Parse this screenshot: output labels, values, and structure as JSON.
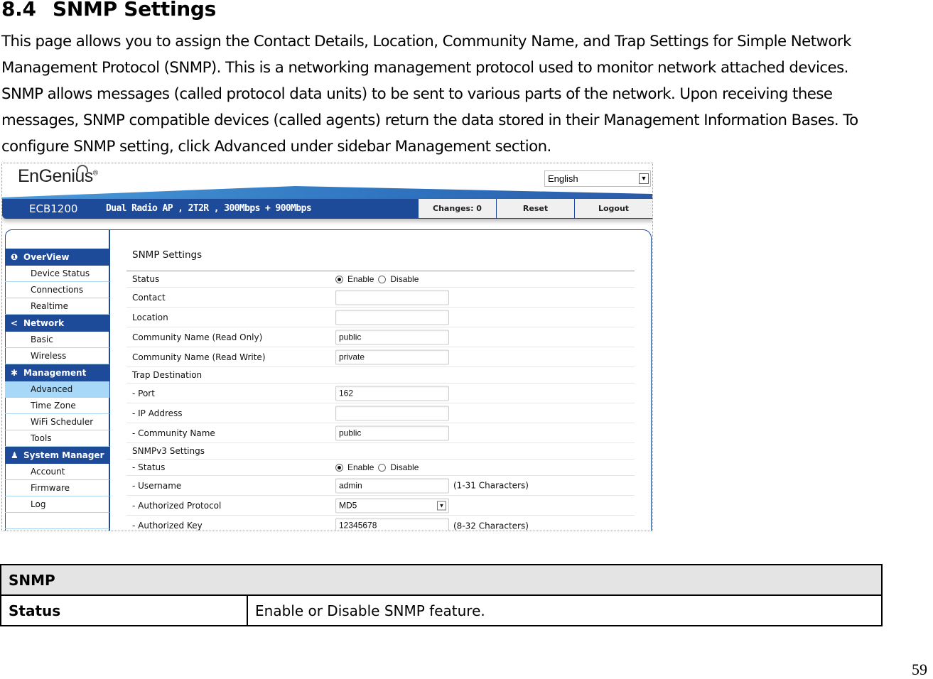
{
  "document": {
    "section_number": "8.4",
    "section_title": "SNMP Settings",
    "paragraph_lines": [
      "This page allows you to assign the Contact Details, Location, Community Name, and Trap Settings for Simple Network",
      "Management Protocol (SNMP). This is a networking management protocol used to monitor network attached devices.",
      "SNMP allows messages (called protocol data units) to be sent to various parts of the network. Upon receiving these",
      "messages, SNMP compatible devices (called agents) return the data stored in their Management Information Bases. To",
      "configure SNMP setting, click Advanced under sidebar Management section."
    ],
    "page_number": "59"
  },
  "ui": {
    "brand": "EnGenius",
    "brand_mark": "®",
    "language_select": "English",
    "model": "ECB1200",
    "model_description": "Dual Radio AP , 2T2R , 300Mbps + 900Mbps",
    "top_buttons": {
      "changes": "Changes: 0",
      "reset": "Reset",
      "logout": "Logout"
    },
    "sidebar": {
      "sections": [
        {
          "icon": "info-icon",
          "glyph": "❶",
          "label": "OverView",
          "items": [
            "Device Status",
            "Connections",
            "Realtime"
          ]
        },
        {
          "icon": "share-icon",
          "glyph": "<",
          "label": "Network",
          "items": [
            "Basic",
            "Wireless"
          ]
        },
        {
          "icon": "gear-icon",
          "glyph": "✱",
          "label": "Management",
          "items": [
            "Advanced",
            "Time Zone",
            "WiFi Scheduler",
            "Tools"
          ]
        },
        {
          "icon": "user-icon",
          "glyph": "♟",
          "label": "System Manager",
          "items": [
            "Account",
            "Firmware",
            "Log"
          ]
        }
      ],
      "active_item": "Advanced"
    },
    "content": {
      "title": "SNMP Settings",
      "radio_enable": "Enable",
      "radio_disable": "Disable",
      "rows": {
        "status": {
          "label": "Status",
          "value": "Enable"
        },
        "contact": {
          "label": "Contact",
          "value": ""
        },
        "location": {
          "label": "Location",
          "value": ""
        },
        "community_ro": {
          "label": "Community Name (Read Only)",
          "value": "public"
        },
        "community_rw": {
          "label": "Community Name (Read Write)",
          "value": "private"
        },
        "trap_destination": {
          "label": "Trap Destination"
        },
        "trap_port": {
          "label": "- Port",
          "value": "162"
        },
        "trap_ip": {
          "label": "- IP Address",
          "value": ""
        },
        "trap_community": {
          "label": "- Community Name",
          "value": "public"
        },
        "snmpv3": {
          "label": "SNMPv3 Settings"
        },
        "v3_status": {
          "label": "- Status",
          "value": "Enable"
        },
        "v3_username": {
          "label": "- Username",
          "value": "admin",
          "hint": "(1-31 Characters)"
        },
        "v3_auth_protocol": {
          "label": "- Authorized Protocol",
          "value": "MD5"
        },
        "v3_auth_key": {
          "label": "- Authorized Key",
          "value": "12345678",
          "hint": "(8-32 Characters)"
        }
      }
    }
  },
  "table": {
    "header": "SNMP",
    "rows": [
      {
        "key": "Status",
        "value": "Enable or Disable SNMP feature."
      }
    ]
  }
}
